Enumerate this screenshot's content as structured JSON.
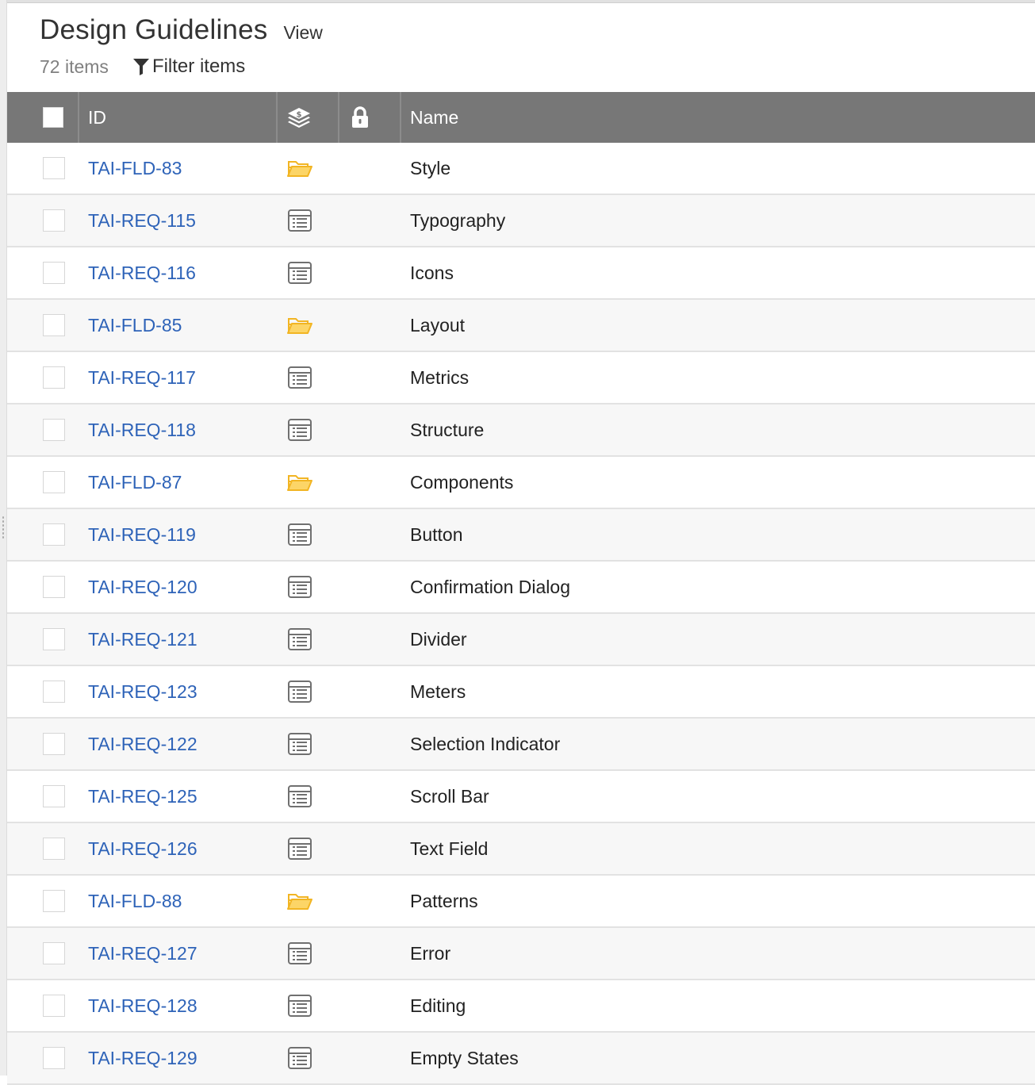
{
  "header": {
    "title": "Design Guidelines",
    "view_label": "View",
    "item_count": "72 items",
    "filter_label": "Filter items"
  },
  "columns": {
    "id": "ID",
    "type_icon": "stack-icon",
    "lock_icon": "lock-icon",
    "name": "Name"
  },
  "colors": {
    "header_bg": "#777777",
    "link": "#2e63b8",
    "folder": "#f5c242"
  },
  "rows": [
    {
      "id": "TAI-FLD-83",
      "type": "folder-icon",
      "name": "Style"
    },
    {
      "id": "TAI-REQ-115",
      "type": "requirement-icon",
      "name": "Typography"
    },
    {
      "id": "TAI-REQ-116",
      "type": "requirement-icon",
      "name": "Icons"
    },
    {
      "id": "TAI-FLD-85",
      "type": "folder-icon",
      "name": "Layout"
    },
    {
      "id": "TAI-REQ-117",
      "type": "requirement-icon",
      "name": "Metrics"
    },
    {
      "id": "TAI-REQ-118",
      "type": "requirement-icon",
      "name": "Structure"
    },
    {
      "id": "TAI-FLD-87",
      "type": "folder-icon",
      "name": "Components"
    },
    {
      "id": "TAI-REQ-119",
      "type": "requirement-icon",
      "name": "Button"
    },
    {
      "id": "TAI-REQ-120",
      "type": "requirement-icon",
      "name": "Confirmation Dialog"
    },
    {
      "id": "TAI-REQ-121",
      "type": "requirement-icon",
      "name": "Divider"
    },
    {
      "id": "TAI-REQ-123",
      "type": "requirement-icon",
      "name": "Meters"
    },
    {
      "id": "TAI-REQ-122",
      "type": "requirement-icon",
      "name": "Selection Indicator"
    },
    {
      "id": "TAI-REQ-125",
      "type": "requirement-icon",
      "name": "Scroll Bar"
    },
    {
      "id": "TAI-REQ-126",
      "type": "requirement-icon",
      "name": "Text Field"
    },
    {
      "id": "TAI-FLD-88",
      "type": "folder-icon",
      "name": "Patterns"
    },
    {
      "id": "TAI-REQ-127",
      "type": "requirement-icon",
      "name": "Error"
    },
    {
      "id": "TAI-REQ-128",
      "type": "requirement-icon",
      "name": "Editing"
    },
    {
      "id": "TAI-REQ-129",
      "type": "requirement-icon",
      "name": "Empty States"
    }
  ]
}
